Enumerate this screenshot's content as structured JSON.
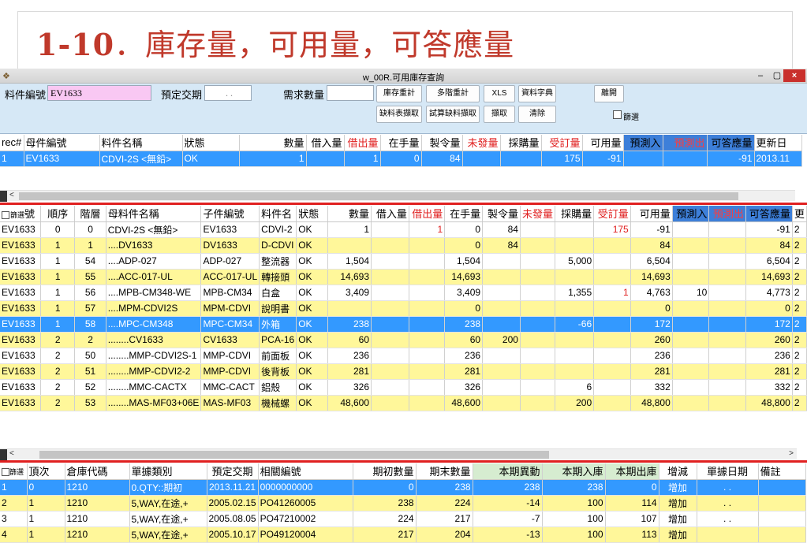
{
  "slide": {
    "title_num": "1-10",
    "title_text": "．庫存量，可用量，可答應量"
  },
  "window": {
    "title": "w_00R.可用庫存查詢",
    "min": "–",
    "max": "▢",
    "close": "×"
  },
  "query": {
    "part_label": "料件編號",
    "part_value": "EV1633",
    "date_label": "預定交期",
    "date_value": ". .",
    "demand_label": "需求數量",
    "demand_value": "",
    "buttons": [
      "庫存重計",
      "多階重計",
      "XLS",
      "資料字典",
      "離開",
      "缺料表擷取",
      "試算缺料擷取",
      "擷取",
      "清除"
    ],
    "filter_label": "篩選"
  },
  "top": {
    "headers": [
      "rec#",
      "母件編號",
      "料件名稱",
      "狀態",
      "數量",
      "借入量",
      "借出量",
      "在手量",
      "製令量",
      "未發量",
      "採購量",
      "受訂量",
      "可用量",
      "預測入",
      "預測出",
      "可答應量",
      "更新日"
    ],
    "rows": [
      [
        "1",
        "EV1633",
        "CDVI-2S <無鉛>",
        "OK",
        "1",
        "",
        "1",
        "0",
        "84",
        "",
        "",
        "175",
        "-91",
        "",
        "",
        "-91",
        "2013.11"
      ]
    ]
  },
  "mid": {
    "filter_label": "篩選",
    "headers": [
      "號",
      "順序",
      "階層",
      "母料件名稱",
      "子件編號",
      "料件名",
      "狀態",
      "數量",
      "借入量",
      "借出量",
      "在手量",
      "製令量",
      "未發量",
      "採購量",
      "受訂量",
      "可用量",
      "預測入",
      "預測出",
      "可答應量",
      "更"
    ],
    "rows": [
      [
        "EV1633",
        "0",
        "0",
        "CDVI-2S <無鉛>",
        "EV1633",
        "CDVI-2",
        "OK",
        "1",
        "",
        "1",
        "0",
        "84",
        "",
        "",
        "175",
        "-91",
        "",
        "",
        "-91",
        "2"
      ],
      [
        "EV1633",
        "1",
        "1",
        "....DV1633",
        "DV1633",
        "D-CDVI",
        "OK",
        "",
        "",
        "",
        "0",
        "84",
        "",
        "",
        "",
        "84",
        "",
        "",
        "84",
        "2"
      ],
      [
        "EV1633",
        "1",
        "54",
        "....ADP-027",
        "ADP-027",
        "整流器",
        "OK",
        "1,504",
        "",
        "",
        "1,504",
        "",
        "",
        "5,000",
        "",
        "6,504",
        "",
        "",
        "6,504",
        "2"
      ],
      [
        "EV1633",
        "1",
        "55",
        "....ACC-017-UL",
        "ACC-017-UL",
        "轉接頭",
        "OK",
        "14,693",
        "",
        "",
        "14,693",
        "",
        "",
        "",
        "",
        "14,693",
        "",
        "",
        "14,693",
        "2"
      ],
      [
        "EV1633",
        "1",
        "56",
        "....MPB-CM348-WE",
        "MPB-CM34",
        "白盒",
        "OK",
        "3,409",
        "",
        "",
        "3,409",
        "",
        "",
        "1,355",
        "1",
        "4,763",
        "10",
        "",
        "4,773",
        "2"
      ],
      [
        "EV1633",
        "1",
        "57",
        "....MPM-CDVI2S",
        "MPM-CDVI",
        "說明書",
        "OK",
        "",
        "",
        "",
        "0",
        "",
        "",
        "",
        "",
        "0",
        "",
        "",
        "0",
        "2"
      ],
      [
        "EV1633",
        "1",
        "58",
        "....MPC-CM348",
        "MPC-CM34",
        "外箱",
        "OK",
        "238",
        "",
        "",
        "238",
        "",
        "",
        "-66",
        "",
        "172",
        "",
        "",
        "172",
        "2"
      ],
      [
        "EV1633",
        "2",
        "2",
        "........CV1633",
        "CV1633",
        "PCA-16",
        "OK",
        "60",
        "",
        "",
        "60",
        "200",
        "",
        "",
        "",
        "260",
        "",
        "",
        "260",
        "2"
      ],
      [
        "EV1633",
        "2",
        "50",
        "........MMP-CDVI2S-1",
        "MMP-CDVI",
        "前面板",
        "OK",
        "236",
        "",
        "",
        "236",
        "",
        "",
        "",
        "",
        "236",
        "",
        "",
        "236",
        "2"
      ],
      [
        "EV1633",
        "2",
        "51",
        "........MMP-CDVI2-2",
        "MMP-CDVI",
        "後背板",
        "OK",
        "281",
        "",
        "",
        "281",
        "",
        "",
        "",
        "",
        "281",
        "",
        "",
        "281",
        "2"
      ],
      [
        "EV1633",
        "2",
        "52",
        "........MMC-CACTX",
        "MMC-CACT",
        "鋁殼",
        "OK",
        "326",
        "",
        "",
        "326",
        "",
        "",
        "6",
        "",
        "332",
        "",
        "",
        "332",
        "2"
      ],
      [
        "EV1633",
        "2",
        "53",
        "........MAS-MF03+06E",
        "MAS-MF03",
        "機械螺",
        "OK",
        "48,600",
        "",
        "",
        "48,600",
        "",
        "",
        "200",
        "",
        "48,800",
        "",
        "",
        "48,800",
        "2"
      ]
    ]
  },
  "bot": {
    "filter_label": "篩選",
    "headers": [
      "頂次",
      "倉庫代碼",
      "單據類別",
      "預定交期",
      "相關編號",
      "期初數量",
      "期末數量",
      "本期異動",
      "本期入庫",
      "本期出庫",
      "增減",
      "單據日期",
      "備註"
    ],
    "rows": [
      [
        "1",
        "0",
        "1210",
        "0.QTY::期初",
        "2013.11.21",
        "0000000000",
        "0",
        "238",
        "238",
        "238",
        "0",
        "增加",
        ". .",
        ""
      ],
      [
        "2",
        "1",
        "1210",
        "5,WAY,在途,+",
        "2005.02.15",
        "PO41260005",
        "238",
        "224",
        "-14",
        "100",
        "114",
        "增加",
        ". .",
        ""
      ],
      [
        "3",
        "1",
        "1210",
        "5,WAY,在途,+",
        "2005.08.05",
        "PO47210002",
        "224",
        "217",
        "-7",
        "100",
        "107",
        "增加",
        ". .",
        ""
      ],
      [
        "4",
        "1",
        "1210",
        "5,WAY,在途,+",
        "2005.10.17",
        "PO49120004",
        "217",
        "204",
        "-13",
        "100",
        "113",
        "增加",
        "",
        ""
      ]
    ]
  }
}
